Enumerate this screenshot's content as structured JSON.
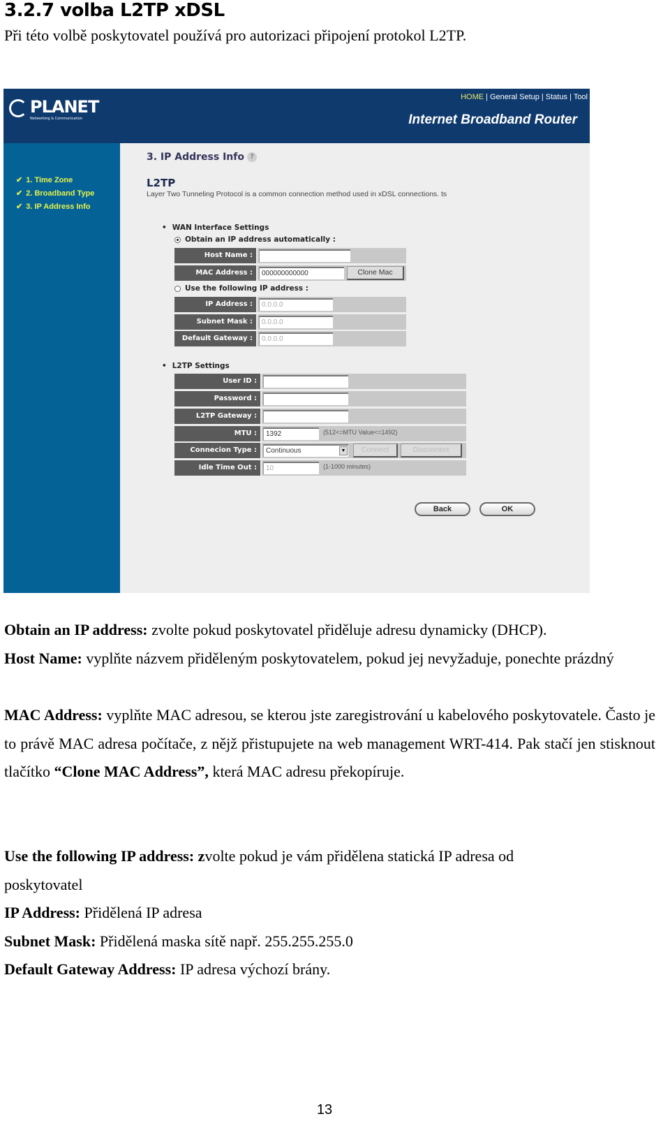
{
  "document": {
    "heading": "3.2.7 volba L2TP xDSL",
    "intro": "Při této volbě poskytovatel používá pro autorizaci připojení protokol L2TP.",
    "page_number": "13"
  },
  "router": {
    "logo": {
      "brand": "PLANET",
      "tagline": "Networking & Communication"
    },
    "nav": [
      "HOME",
      "General Setup",
      "Status",
      "Tool"
    ],
    "title": "Internet Broadband Router",
    "sidebar_steps": [
      {
        "label": "1. Time Zone",
        "icon": "check-icon"
      },
      {
        "label": "2. Broadband Type",
        "icon": "check-icon"
      },
      {
        "label": "3. IP Address Info",
        "icon": "check-icon"
      }
    ],
    "section_title": "3. IP Address Info",
    "help_icon": "?",
    "mode_title": "L2TP",
    "mode_desc": "Layer Two Tunneling Protocol is a common connection method used in xDSL connections. ts",
    "wan": {
      "group_label": "WAN Interface Settings",
      "auto_radio": {
        "label": "Obtain an IP address automatically :",
        "selected": true
      },
      "host_name": {
        "label": "Host Name :",
        "value": ""
      },
      "mac_address": {
        "label": "MAC Address :",
        "value": "000000000000"
      },
      "clone_mac_label": "Clone Mac",
      "static_radio": {
        "label": "Use the following IP address :",
        "selected": false
      },
      "ip_address": {
        "label": "IP Address :",
        "value": "0.0.0.0"
      },
      "subnet_mask": {
        "label": "Subnet Mask :",
        "value": "0.0.0.0"
      },
      "default_gateway": {
        "label": "Default Gateway :",
        "value": "0.0.0.0"
      }
    },
    "l2tp": {
      "group_label": "L2TP Settings",
      "user_id": {
        "label": "User ID :",
        "value": ""
      },
      "password": {
        "label": "Password :",
        "value": ""
      },
      "gateway": {
        "label": "L2TP Gateway :",
        "value": ""
      },
      "mtu": {
        "label": "MTU :",
        "value": "1392",
        "note": "(512<=MTU Value<=1492)"
      },
      "connection_type": {
        "label": "Connecion Type :",
        "value": "Continuous"
      },
      "connect_label": "Connect",
      "disconnect_label": "Disconnect",
      "idle_timeout": {
        "label": "Idle Time Out :",
        "value": "10",
        "note": "(1-1000 minutes)"
      }
    },
    "back_label": "Back",
    "ok_label": "OK"
  },
  "paragraphs": {
    "p1_term": "Obtain an IP address:",
    "p1_text": " zvolte pokud poskytovatel přiděluje adresu dynamicky (DHCP).",
    "p2_term": "Host Name:",
    "p2_text": " vyplňte názvem přiděleným poskytovatelem, pokud jej nevyžaduje, ponechte prázdný",
    "p3_term": "MAC Address:",
    "p3_text1": " vyplňte MAC adresou, se kterou jste zaregistrování u kabelového poskytovatele. Často je to právě MAC adresa počítače, z nějž přistupujete na web management WRT-414. Pak stačí jen stisknout tlačítko ",
    "p3_bold": "“Clone MAC Address”,",
    "p3_text2": " která MAC adresu překopíruje.",
    "p4_term": "Use the following IP address: z",
    "p4_text": "volte pokud je vám přidělena statická IP adresa od poskytovatel",
    "p5_term": "IP Address:",
    "p5_text": " Přidělená IP adresa",
    "p6_term": "Subnet Mask:",
    "p6_text": " Přidělená maska sítě např. 255.255.255.0",
    "p7_term": "Default Gateway Address:",
    "p7_text": " IP adresa výchozí brány."
  }
}
